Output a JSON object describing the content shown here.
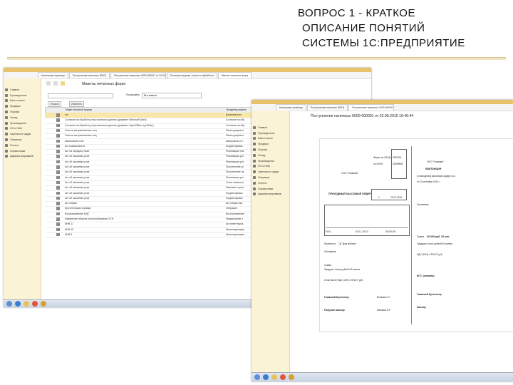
{
  "slide": {
    "title_lines": [
      "ВОПРОС 1 - КРАТКОЕ",
      "ОПИСАНИЕ ПОНЯТИЙ",
      "СИСТЕМЫ 1С:ПРЕДПРИЯТИЕ"
    ]
  },
  "window_a": {
    "tabs": [
      "Начальная страница",
      "Поступление наличных (ПКО)",
      "Поступление наличных 0000-000001 от 23.09.2015 10:46:44",
      "Печатные формы, отчеты и обработки",
      "Макеты печатных форм"
    ],
    "page_title": "Макеты печатных форм",
    "toolbar": {
      "open": "Открыть",
      "edit": "Изменить",
      "search_label": "Показывать:",
      "search_value": "Все макеты"
    },
    "columns": {
      "name": "Макет печатной формы",
      "owner": "Владелец макета"
    },
    "sidebar": [
      "Главное",
      "Руководителю",
      "Банк и касса",
      "Продажи",
      "Покупки",
      "Склад",
      "Производство",
      "ОС и НМА",
      "Зарплата и кадры",
      "Операции",
      "Отчеты",
      "Справочники",
      "Администрирование"
    ],
    "rows": [
      {
        "name": "Акт",
        "owner": "Доверенность"
      },
      {
        "name": "Согласие на обработку персональных данных (документ Microsoft Word)",
        "owner": "Согласие на обр."
      },
      {
        "name": "Согласие на обработку персональных данных (документ OpenOffice.org Writer)",
        "owner": "Согласие на обр."
      },
      {
        "name": "Список застрахованных лиц",
        "owner": "Пачка документ."
      },
      {
        "name": "Список застрахованных лиц",
        "owner": "Пачка документ."
      },
      {
        "name": "Авансовый отчет",
        "owner": "Авансовый отч."
      },
      {
        "name": "Акт взаимозачета",
        "owner": "Корректировка"
      },
      {
        "name": "Акт на передачу прав",
        "owner": "Реализация тов."
      },
      {
        "name": "Акт об оказании услуг",
        "owner": "Реализация усл."
      },
      {
        "name": "Акт об оказании услуг",
        "owner": "Реализация усл."
      },
      {
        "name": "Акт об оказании услуг",
        "owner": "Поступление ус."
      },
      {
        "name": "Акт об оказании услуг",
        "owner": "Поступление на."
      },
      {
        "name": "Акт об оказании услуг",
        "owner": "Реализация усл."
      },
      {
        "name": "Акт об оказании услуг",
        "owner": "Отчет комиссио."
      },
      {
        "name": "Акт об оказании услуг",
        "owner": "Оказание произ."
      },
      {
        "name": "Акт об оказании услуг",
        "owner": "Корректировка"
      },
      {
        "name": "Акт об оказании услуг",
        "owner": "Корректировка"
      },
      {
        "name": "Акт сверки",
        "owner": "Акт сверки вза."
      },
      {
        "name": "Бухгалтерская справка",
        "owner": "Операция"
      },
      {
        "name": "Восстановление НДС",
        "owner": "Восстановление"
      },
      {
        "name": "Изменение объекта налогообложения УСН",
        "owner": "Уведомление о"
      },
      {
        "name": "ИНВ-17",
        "owner": "Акт инвентариз."
      },
      {
        "name": "ИНВ-19",
        "owner": "Инвентаризация"
      },
      {
        "name": "ИНВ-3",
        "owner": "Инвентаризация"
      }
    ]
  },
  "window_b": {
    "tabs": [
      "Начальная страница",
      "Поступление наличных (ПКО)",
      "Поступление наличных 0000-000001 от 23.09.2015 10:46:44"
    ],
    "doc_title": "Поступление наличных 0000-000001 от 23.09.2015 10:46:44",
    "print_button": "Печать",
    "copies": "1",
    "sidebar": [
      "Главное",
      "Руководителю",
      "Банк и касса",
      "Продажи",
      "Покупки",
      "Склад",
      "Производство",
      "ОС и НМА",
      "Зарплата и кадры",
      "Операции",
      "Отчеты",
      "Справочники",
      "Администрирование"
    ],
    "order": {
      "heading": "ПРИХОДНЫЙ КАССОВЫЙ ОРДЕР",
      "org": "ООО \"Олимпия\"",
      "okud_label": "Форма по ОКУД",
      "okud": "0310001",
      "okpo_label": "по ОКПО",
      "okpo": "32089606",
      "number": "1",
      "date": "23.09.2015",
      "sum": "30 000,00",
      "account": "50.01",
      "credit": "62.01, 62.02",
      "from_label": "Принято от",
      "from": "ТД \"Дом мебели\"",
      "basis_label": "Основание:",
      "amount_label": "Сумма",
      "amount_words": "Тридцать тысяч рублей 00 копеек",
      "vat_line": "в том числе  НДС (18%) 4 576,27 руб.",
      "chief_label": "Главный бухгалтер",
      "cashier_label": "Получил кассир",
      "chief_name": "Волкова О.Г.",
      "cashier_name": "Иванова А.Р.",
      "receipt_title": "КВИТАНЦИЯ",
      "receipt_org": "ООО \"Олимпия\"",
      "receipt_order": "к приходному кассовому ордеру № 1",
      "receipt_date": "от  23 сентября 2015 г.",
      "receipt_sum": "30 000 руб. 00 коп.",
      "receipt_words": "Тридцать тысяч рублей 00 копеек",
      "receipt_vat": "НДС (18%) 4 576,27 руб.",
      "stamp": "М.П. (штампа)",
      "receipt_chief": "Главный бухгалтер",
      "receipt_cashier": "Кассир"
    }
  },
  "colors": {
    "sidebar_bg": "#fbf3d6",
    "titlebar": "#e9c36b",
    "selection": "#f9e7a8",
    "rule": "#d9c48a"
  }
}
